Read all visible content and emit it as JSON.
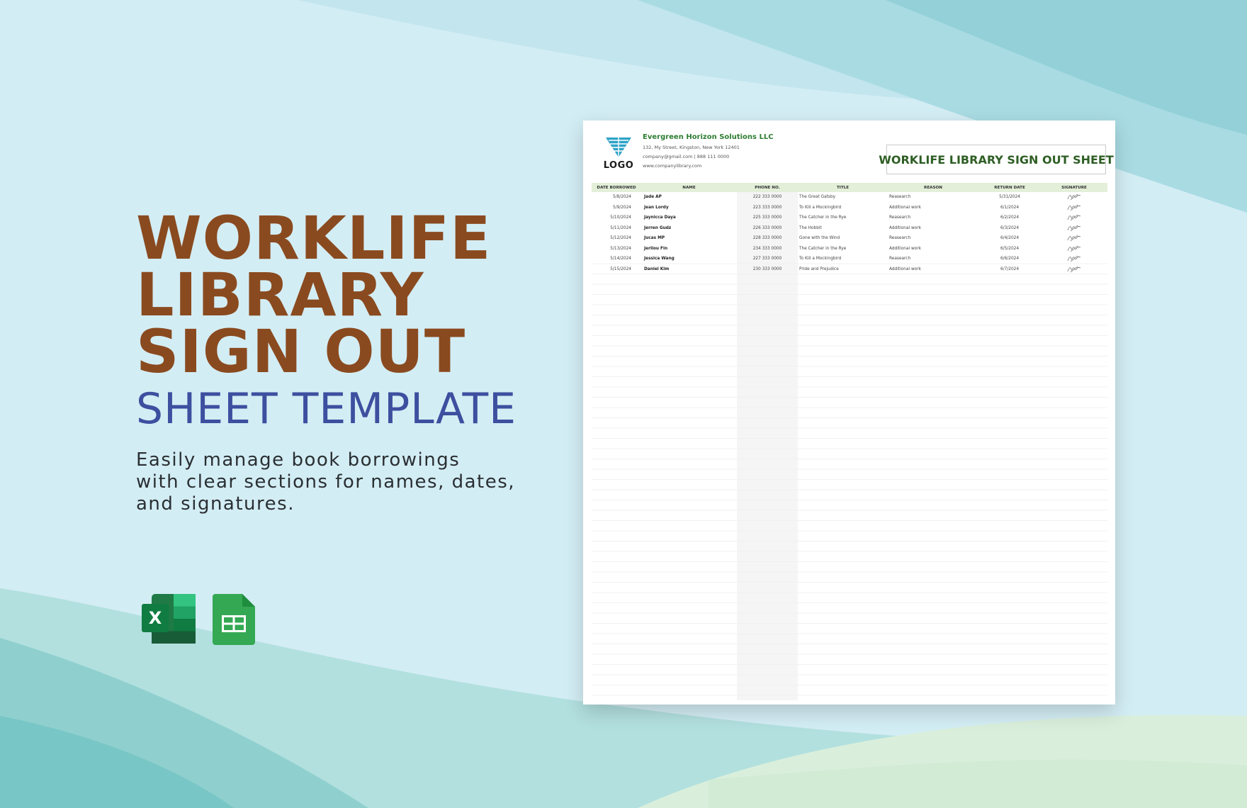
{
  "hero": {
    "title_lines": [
      "WORKLIFE",
      "LIBRARY",
      "SIGN OUT"
    ],
    "subtitle": "SHEET TEMPLATE",
    "description_lines": [
      "Easily manage book borrowings",
      "with clear sections for names, dates,",
      "and signatures."
    ]
  },
  "app_icons": {
    "excel_letter": "X",
    "excel_icon": "microsoft-excel-icon",
    "sheets_icon": "google-sheets-icon"
  },
  "colors": {
    "title_brown": "#8a4a1f",
    "subtitle_blue": "#3d4f9f",
    "sheet_green": "#2e7d32",
    "header_band": "#e3efd8"
  },
  "sheet": {
    "logo_text": "LOGO",
    "company": {
      "name": "Evergreen Horizon Solutions LLC",
      "address": "132, My Street, Kingston, New York 12401",
      "contact": "company@gmail.com | 888 111 0000",
      "website": "www.companylibrary.com"
    },
    "title": "WORKLIFE LIBRARY SIGN OUT SHEET",
    "columns": [
      "DATE BORROWED",
      "NAME",
      "PHONE NO.",
      "TITLE",
      "REASON",
      "RETURN DATE",
      "SIGNATURE"
    ],
    "rows": [
      [
        "5/8/2024",
        "Jade AP",
        "222 333 0000",
        "The Great Gatsby",
        "Reasearch",
        "5/31/2024"
      ],
      [
        "5/9/2024",
        "Jean Lordy",
        "223 333 0000",
        "To Kill a Mockingbird",
        "Additional work",
        "6/1/2024"
      ],
      [
        "5/10/2024",
        "Jaynicca Daya",
        "225 333 0000",
        "The Catcher in the Rye",
        "Reasearch",
        "6/2/2024"
      ],
      [
        "5/11/2024",
        "Jerren Gudz",
        "226 333 0000",
        "The Hobbit",
        "Additional work",
        "6/3/2024"
      ],
      [
        "5/12/2024",
        "Jucas MP",
        "228 333 0000",
        "Gone with the Wind",
        "Reasearch",
        "6/4/2024"
      ],
      [
        "5/13/2024",
        "Jerilou Fin",
        "234 333 0000",
        "The Catcher in the Rye",
        "Additional work",
        "6/5/2024"
      ],
      [
        "5/14/2024",
        "Jessica Wang",
        "227 333 0000",
        "To Kill a Mockingbird",
        "Reasearch",
        "6/6/2024"
      ],
      [
        "5/15/2024",
        "Daniel Kim",
        "230 333 0000",
        "Pride and Prejudice",
        "Additional work",
        "6/7/2024"
      ]
    ]
  }
}
